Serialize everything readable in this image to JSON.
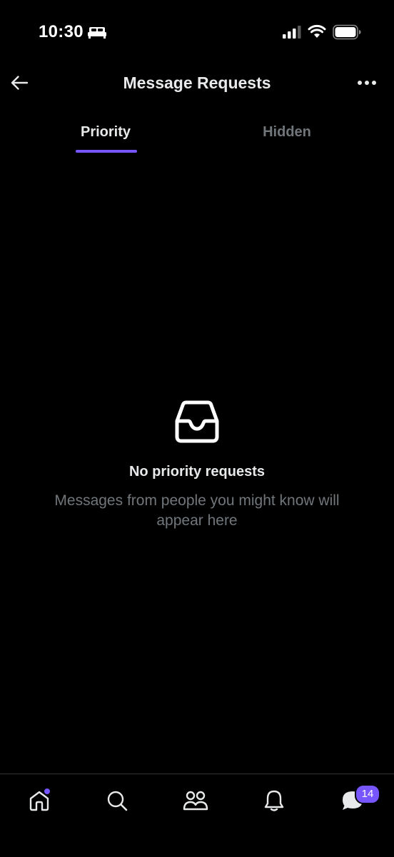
{
  "status_bar": {
    "time": "10:30"
  },
  "header": {
    "title": "Message Requests"
  },
  "tabs": [
    {
      "label": "Priority",
      "active": true
    },
    {
      "label": "Hidden",
      "active": false
    }
  ],
  "empty_state": {
    "title": "No priority requests",
    "subtitle": "Messages from people you might know will appear here"
  },
  "bottom_nav": {
    "items": [
      {
        "icon": "home-icon",
        "indicator_dot": true
      },
      {
        "icon": "search-icon"
      },
      {
        "icon": "people-icon"
      },
      {
        "icon": "bell-icon"
      },
      {
        "icon": "messages-icon",
        "badge": "14"
      }
    ]
  },
  "colors": {
    "background": "#000000",
    "accent": "#7856ff",
    "primary_text": "#e7e9ea",
    "secondary_text": "#71767b",
    "divider": "#2f3336"
  }
}
